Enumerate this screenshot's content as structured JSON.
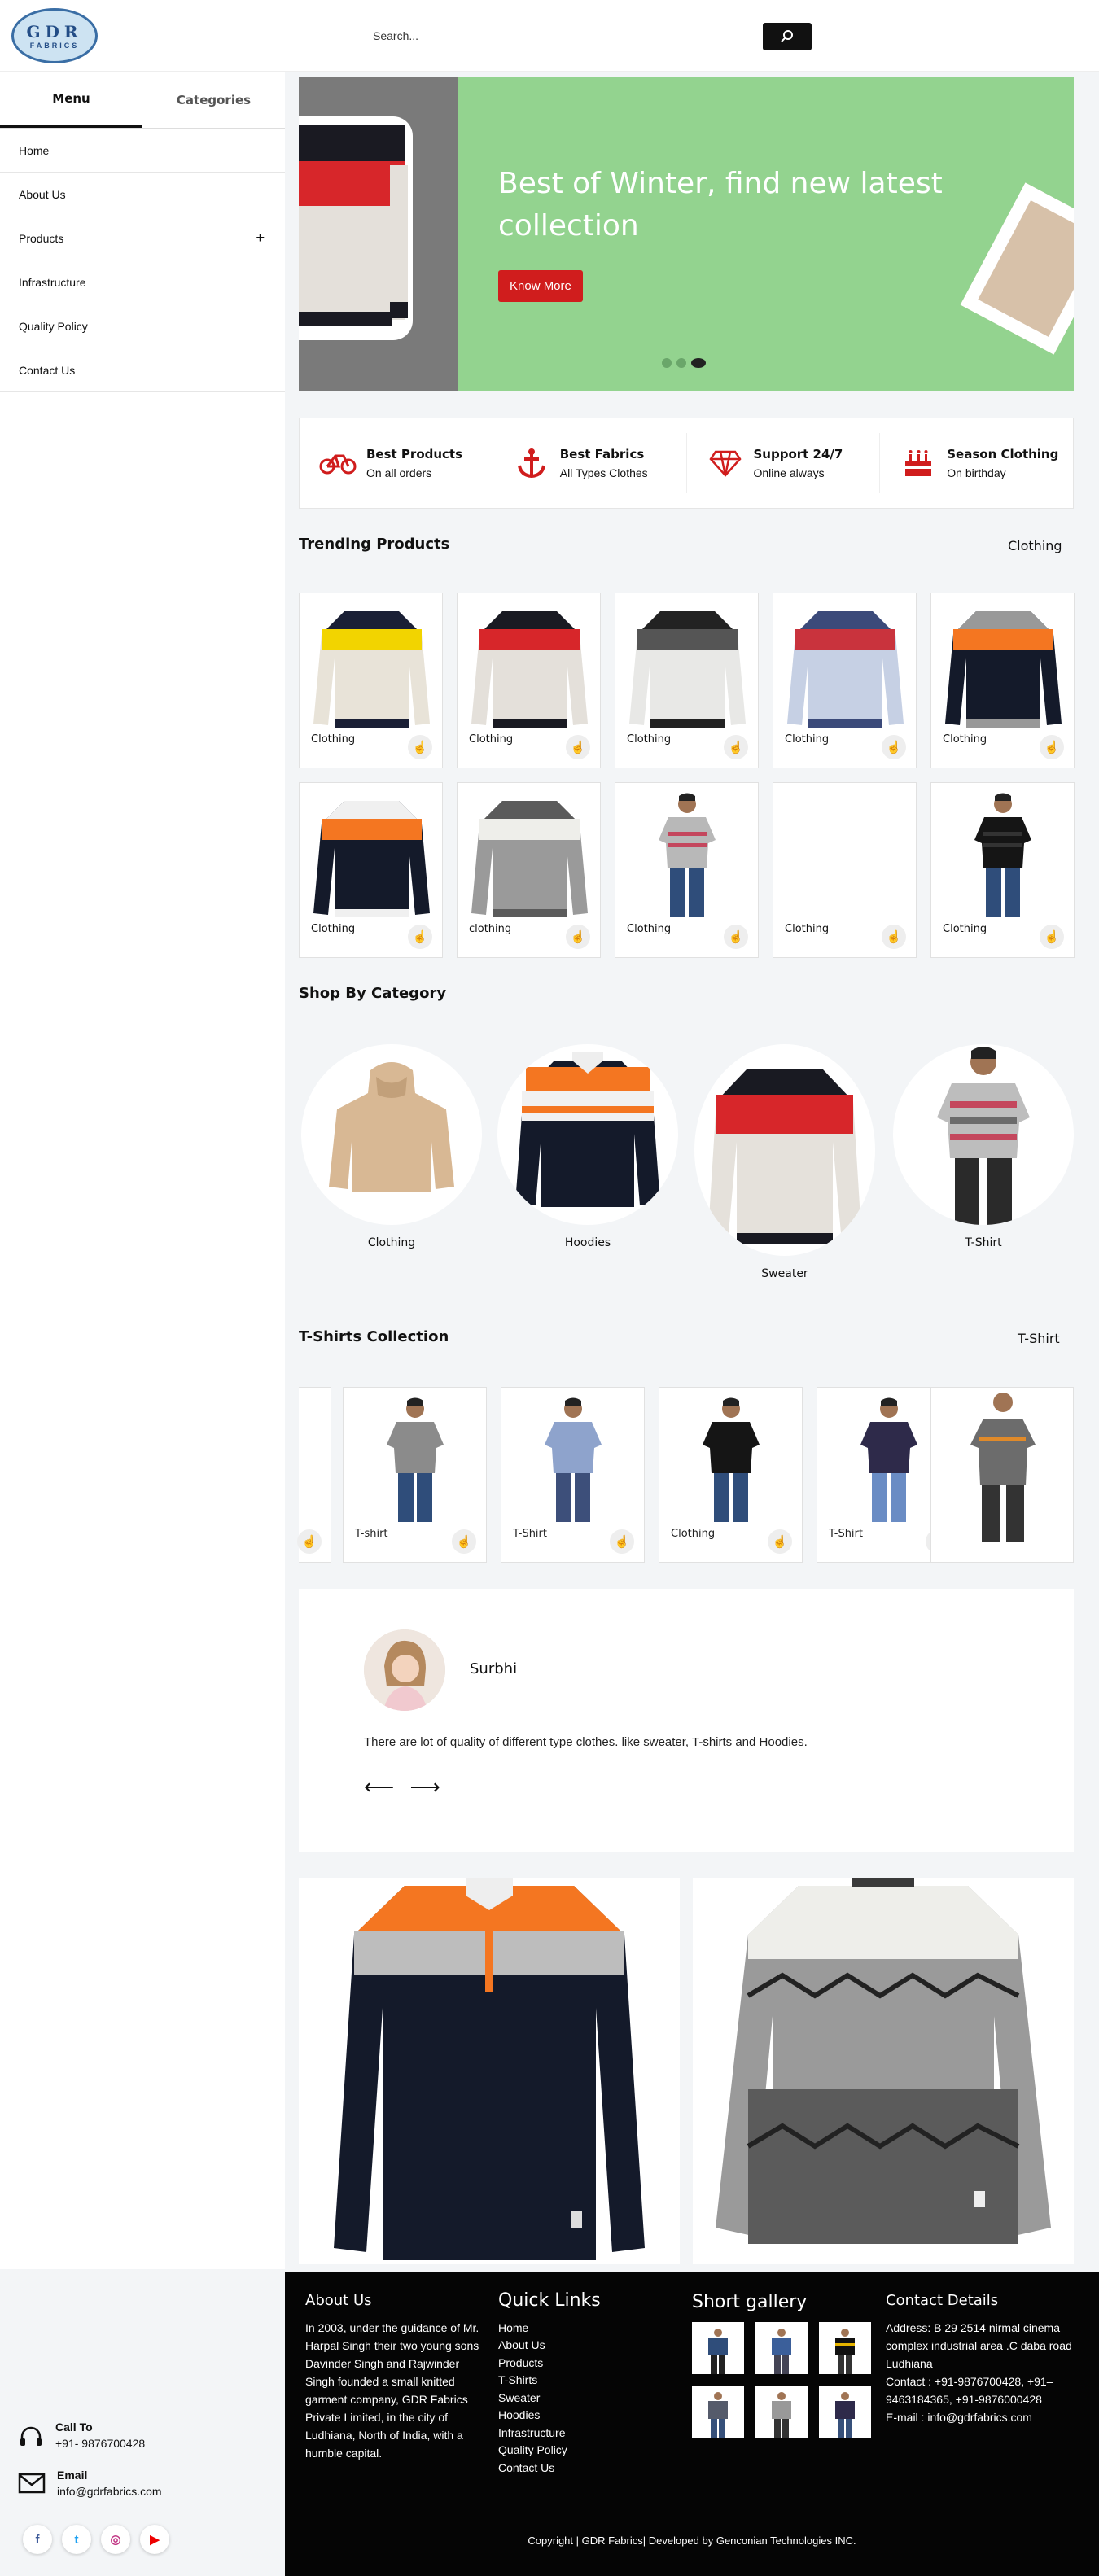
{
  "header": {
    "logo_text": "GDR",
    "logo_sub": "FABRICS",
    "search_placeholder": "Search..."
  },
  "sidebar": {
    "tabs": [
      "Menu",
      "Categories"
    ],
    "items": [
      "Home",
      "About Us",
      "Products",
      "Infrastructure",
      "Quality Policy",
      "Contact Us"
    ],
    "products_expand": "+",
    "call_label": "Call To",
    "call_value": "+91- 9876700428",
    "email_label": "Email",
    "email_value": "info@gdrfabrics.com",
    "social_icons": [
      "facebook-icon",
      "twitter-icon",
      "instagram-icon",
      "youtube-icon"
    ]
  },
  "hero": {
    "title": "Best of Winter, find new latest collection",
    "button": "Know More",
    "active_slide": 3,
    "slide_count": 3
  },
  "features": [
    {
      "icon": "bicycle-icon",
      "title": "Best Products",
      "sub": "On all orders"
    },
    {
      "icon": "anchor-icon",
      "title": "Best Fabrics",
      "sub": "All Types Clothes"
    },
    {
      "icon": "diamond-icon",
      "title": "Support 24/7",
      "sub": "Online always"
    },
    {
      "icon": "cake-icon",
      "title": "Season Clothing",
      "sub": "On birthday"
    }
  ],
  "trending": {
    "title": "Trending Products",
    "link": "Clothing",
    "products": [
      {
        "label": "Clothing",
        "img": "sweater-yellow"
      },
      {
        "label": "Clothing",
        "img": "sweater-red"
      },
      {
        "label": "Clothing",
        "img": "sweater-grey"
      },
      {
        "label": "Clothing",
        "img": "sweater-striped"
      },
      {
        "label": "Clothing",
        "img": "sweater-navy"
      },
      {
        "label": "Clothing",
        "img": "sweater-orange"
      },
      {
        "label": "clothing",
        "img": "sweater-zigzag"
      },
      {
        "label": "Clothing",
        "img": "tshirt-stripe"
      },
      {
        "label": "Clothing",
        "img": "blank"
      },
      {
        "label": "Clothing",
        "img": "tshirt-black"
      }
    ]
  },
  "categories": {
    "title": "Shop By Category",
    "items": [
      "Clothing",
      "Hoodies",
      "Sweater",
      "T-Shirt"
    ]
  },
  "tshirts": {
    "title": "T-Shirts Collection",
    "link": "T-Shirt",
    "items": [
      "T-shirt",
      "T-Shirt",
      "Clothing",
      "T-Shirt"
    ]
  },
  "testimonial": {
    "name": "Surbhi",
    "text": "There are lot of quality of different type clothes. like sweater, T-shirts and Hoodies.",
    "arrows": "⟵ ⟶"
  },
  "footer": {
    "about_title": "About Us",
    "about_text": "In 2003, under the guidance of Mr. Harpal Singh their two young sons Davinder Singh and Rajwinder Singh founded a small knitted garment company, GDR Fabrics Private Limited, in the city of Ludhiana, North of India, with a humble capital.",
    "links_title": "Quick Links",
    "links": [
      "Home",
      "About Us",
      "Products",
      "T-Shirts",
      "Sweater",
      "Hoodies",
      "Infrastructure",
      "Quality Policy",
      "Contact Us"
    ],
    "gallery_title": "Short gallery",
    "contact_title": "Contact Details",
    "address": "Address: B 29 2514 nirmal cinema complex industrial area .C daba road Ludhiana",
    "contact": "Contact : +91-9876700428, +91–9463184365, +91-9876000428",
    "email": "E-mail : info@gdrfabrics.com",
    "copyright": "Copyright | GDR Fabrics| Developed by Genconian Technologies INC."
  },
  "colors": {
    "accent_red": "#d01d1d",
    "hero_green": "#93d38f",
    "footer_bg": "#050505"
  }
}
